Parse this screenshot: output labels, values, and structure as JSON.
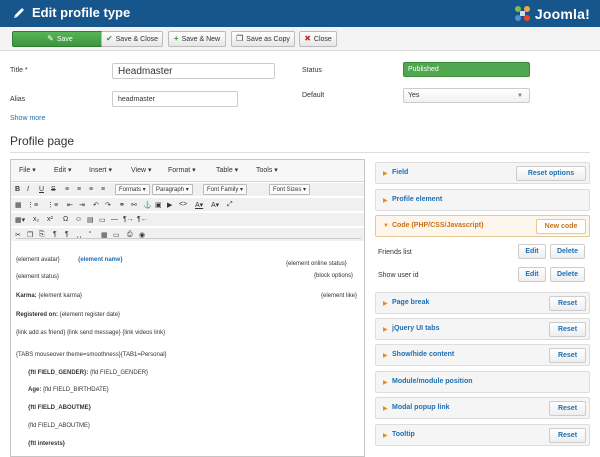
{
  "header": {
    "title": "Edit profile type",
    "logo_text": "Joomla!"
  },
  "toolbar": {
    "save": "Save",
    "save_close": "Save & Close",
    "save_new": "Save & New",
    "save_copy": "Save as Copy",
    "close": "Close"
  },
  "form": {
    "title_label": "Title *",
    "title_value": "Headmaster",
    "alias_label": "Alias",
    "alias_value": "headmaster",
    "status_label": "Status",
    "status_value": "Published",
    "default_label": "Default",
    "default_value": "Yes",
    "show_more": "Show more"
  },
  "section_title": "Profile page",
  "editor": {
    "menus": [
      "File",
      "Edit",
      "Insert",
      "View",
      "Format",
      "Table",
      "Tools"
    ],
    "dropdowns": [
      "Formats",
      "Paragraph",
      "Font Family",
      "Font Sizes"
    ],
    "lines": {
      "avatar": "{element avatar}",
      "name": "{element name}",
      "online": "{element online status}",
      "status": "{element status}",
      "block": "{block options}",
      "karma_label": "Karma:",
      "karma": "{element karma}",
      "like": "{element like}",
      "registered_label": "Registered on:",
      "registered": "{element register date}",
      "links": "{link add as friend}  {link send message}   {link videos link}",
      "tabs": "{TABS mouseover theme=smoothness}{TAB1=Personal}",
      "gender_b": "{ftl FIELD_GENDER}:",
      "gender": " {fld FIELD_GENDER}",
      "age_b": "Age:",
      "age": " {fld FIELD_BIRTHDATE}",
      "aboutme_b": "{ftl FIELD_ABOUTME}",
      "aboutme": "{fld FIELD_ABOUTME}",
      "interests_b": "{ftl interests}"
    }
  },
  "panel": {
    "field": {
      "title": "Field",
      "button": "Reset options"
    },
    "profile_element": {
      "title": "Profile element"
    },
    "code": {
      "title": "Code (PHP/CSS/Javascript)",
      "button": "New code"
    },
    "rows": [
      {
        "label": "Friends list",
        "edit": "Edit",
        "delete": "Delete"
      },
      {
        "label": "Show user id",
        "edit": "Edit",
        "delete": "Delete"
      }
    ],
    "page_break": {
      "title": "Page break",
      "button": "Reset"
    },
    "jquery_tabs": {
      "title": "jQuery UI tabs",
      "button": "Reset"
    },
    "show_hide": {
      "title": "Show/hide content",
      "button": "Reset"
    },
    "module": {
      "title": "Module/module position"
    },
    "modal": {
      "title": "Modal popup link",
      "button": "Reset"
    },
    "tooltip": {
      "title": "Tooltip",
      "button": "Reset"
    }
  },
  "colors": {
    "header_bg": "#17568c",
    "accent_blue": "#1e6eb4",
    "accent_orange": "#e48a1a",
    "published_green": "#4fa84f"
  }
}
